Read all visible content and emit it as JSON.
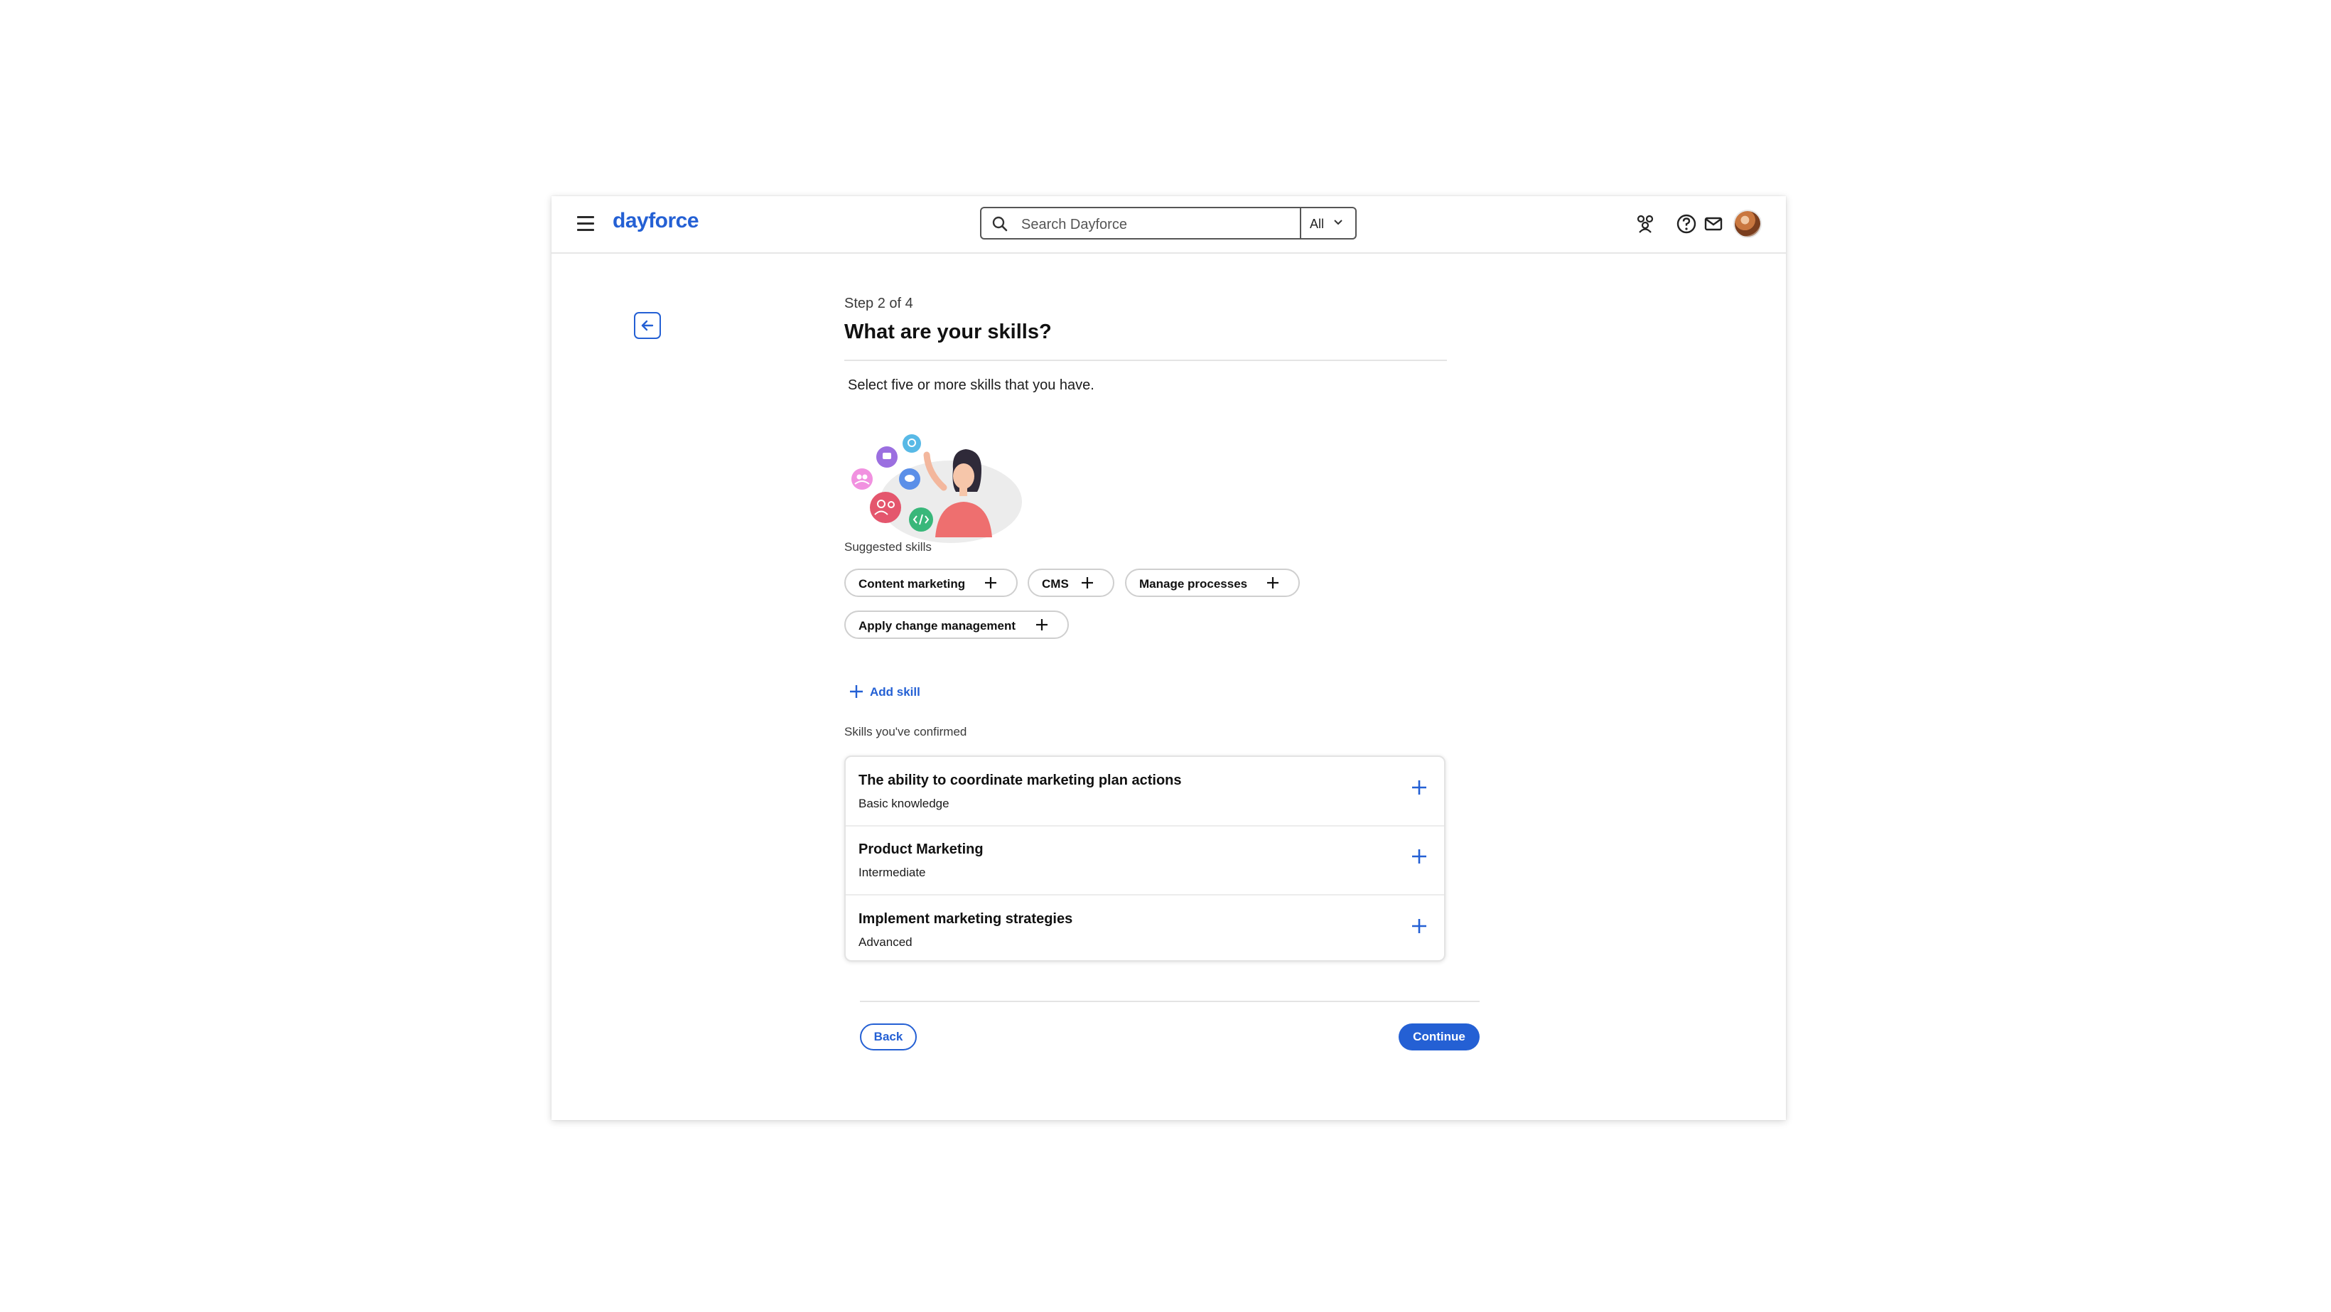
{
  "header": {
    "logo": "dayforce",
    "search": {
      "placeholder": "Search Dayforce",
      "scope": "All"
    },
    "icons": [
      "people-icon",
      "help-icon",
      "mail-icon",
      "avatar"
    ]
  },
  "main": {
    "step": "Step 2 of 4",
    "title": "What are your skills?",
    "instruction": "Select five or more skills that you have.",
    "suggested_label": "Suggested skills",
    "suggested_skills": [
      "Content marketing",
      "CMS",
      "Manage processes",
      "Apply change management"
    ],
    "add_skill": "Add skill",
    "confirmed_label": "Skills you've confirmed",
    "confirmed_skills": [
      {
        "name": "The ability to coordinate marketing plan actions",
        "level": "Basic knowledge"
      },
      {
        "name": "Product Marketing",
        "level": "Intermediate"
      },
      {
        "name": "Implement marketing strategies",
        "level": "Advanced"
      }
    ]
  },
  "footer": {
    "back": "Back",
    "continue": "Continue"
  },
  "colors": {
    "accent": "#2460d4",
    "border": "#cfcfcf",
    "text": "#111111"
  }
}
